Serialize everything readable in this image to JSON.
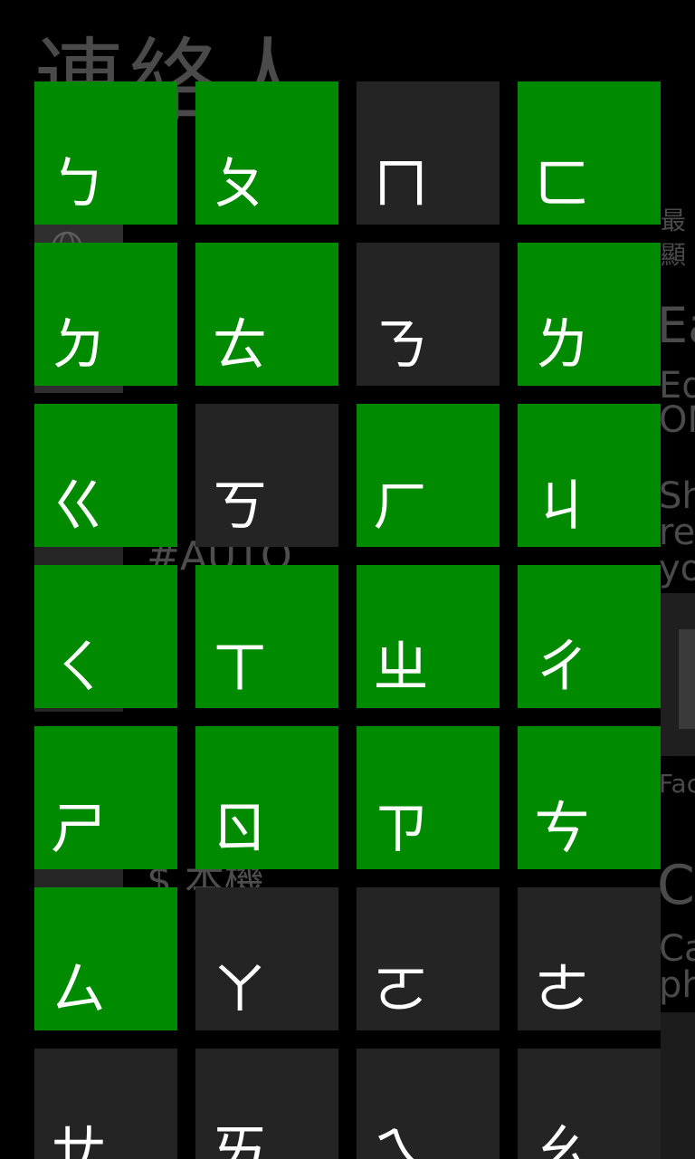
{
  "background": {
    "title": "連絡人",
    "peek_lines": [
      "最",
      "顯",
      "Ea",
      "Ed",
      "ON",
      "Sh",
      "rec",
      "yo",
      "Fac",
      "C",
      "Ca",
      "ph"
    ],
    "group_auto": "#AUTO",
    "group_dollar": "$ 本機"
  },
  "colors": {
    "active_tile": "#008a00",
    "inactive_tile": "#242424",
    "glyph": "#ffffff",
    "background": "#000000"
  },
  "tiles": [
    {
      "label": "ㄅ",
      "active": true
    },
    {
      "label": "ㄆ",
      "active": true
    },
    {
      "label": "ㄇ",
      "active": false
    },
    {
      "label": "ㄈ",
      "active": true
    },
    {
      "label": "ㄉ",
      "active": true
    },
    {
      "label": "ㄊ",
      "active": true
    },
    {
      "label": "ㄋ",
      "active": false
    },
    {
      "label": "ㄌ",
      "active": true
    },
    {
      "label": "ㄍ",
      "active": true
    },
    {
      "label": "ㄎ",
      "active": false
    },
    {
      "label": "ㄏ",
      "active": true
    },
    {
      "label": "ㄐ",
      "active": true
    },
    {
      "label": "ㄑ",
      "active": true
    },
    {
      "label": "ㄒ",
      "active": true
    },
    {
      "label": "ㄓ",
      "active": true
    },
    {
      "label": "ㄔ",
      "active": true
    },
    {
      "label": "ㄕ",
      "active": true
    },
    {
      "label": "ㄖ",
      "active": true
    },
    {
      "label": "ㄗ",
      "active": true
    },
    {
      "label": "ㄘ",
      "active": true
    },
    {
      "label": "ㄙ",
      "active": true
    },
    {
      "label": "ㄚ",
      "active": false
    },
    {
      "label": "ㄛ",
      "active": false
    },
    {
      "label": "ㄜ",
      "active": false
    },
    {
      "label": "ㄝ",
      "active": false
    },
    {
      "label": "ㄞ",
      "active": false
    },
    {
      "label": "ㄟ",
      "active": false
    },
    {
      "label": "ㄠ",
      "active": false
    }
  ]
}
